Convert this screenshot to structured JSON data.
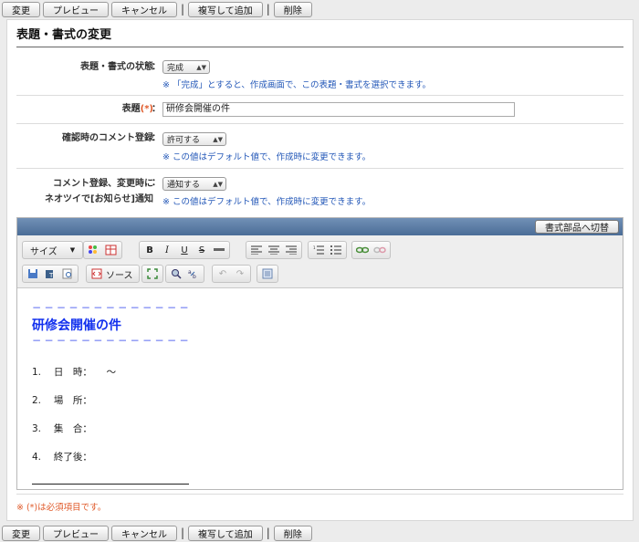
{
  "toolbar": {
    "edit_label": "変更",
    "preview_label": "プレビュー",
    "cancel_label": "キャンセル",
    "copy_label": "複写して追加",
    "delete_label": "削除",
    "separator": "|"
  },
  "form": {
    "title": "表題・書式の変更",
    "status": {
      "label": "表題・書式の状態",
      "value": "完成",
      "note": "「完成」とすると、作成画面で、この表題・書式を選択できます。"
    },
    "subject": {
      "label": "表題",
      "required_mark": "(*)",
      "value": "研修会開催の件"
    },
    "comment": {
      "label": "確認時のコメント登録",
      "value": "許可する",
      "note": "この値はデフォルト値で、作成時に変更できます。"
    },
    "notify": {
      "label_line1": "コメント登録、変更時に",
      "label_line2": "ネオツイで[お知らせ]通知",
      "value": "通知する",
      "note": "この値はデフォルト値で、作成時に変更できます。"
    },
    "colon": "：",
    "note_mark": "※",
    "footnote": "※ (*)は必須項目です。"
  },
  "editor": {
    "switch_label": "書式部品へ切替",
    "sizes_label": "サイズ",
    "source_label": "ソース",
    "toolbar_icons": [
      "text-color-icon",
      "table-icon",
      "bold-icon",
      "italic-icon",
      "underline-icon",
      "strike-icon",
      "hr-icon",
      "align-left-icon",
      "align-center-icon",
      "align-right-icon",
      "ordered-list-icon",
      "bullet-list-icon",
      "link-icon",
      "unlink-icon",
      "save-icon",
      "paste-text-icon",
      "preview-icon",
      "source-icon",
      "maximize-icon",
      "find-icon",
      "replace-icon",
      "undo-icon",
      "redo-icon",
      "select-all-icon"
    ],
    "content": {
      "dashes": "−−−−−−−−−−−−−−−−−−−−",
      "title": "研修会開催の件",
      "items": [
        "1.　 日　時：　　〜",
        "2.　 場　所：",
        "3.　 集　合：",
        "4.　 終了後："
      ]
    }
  }
}
